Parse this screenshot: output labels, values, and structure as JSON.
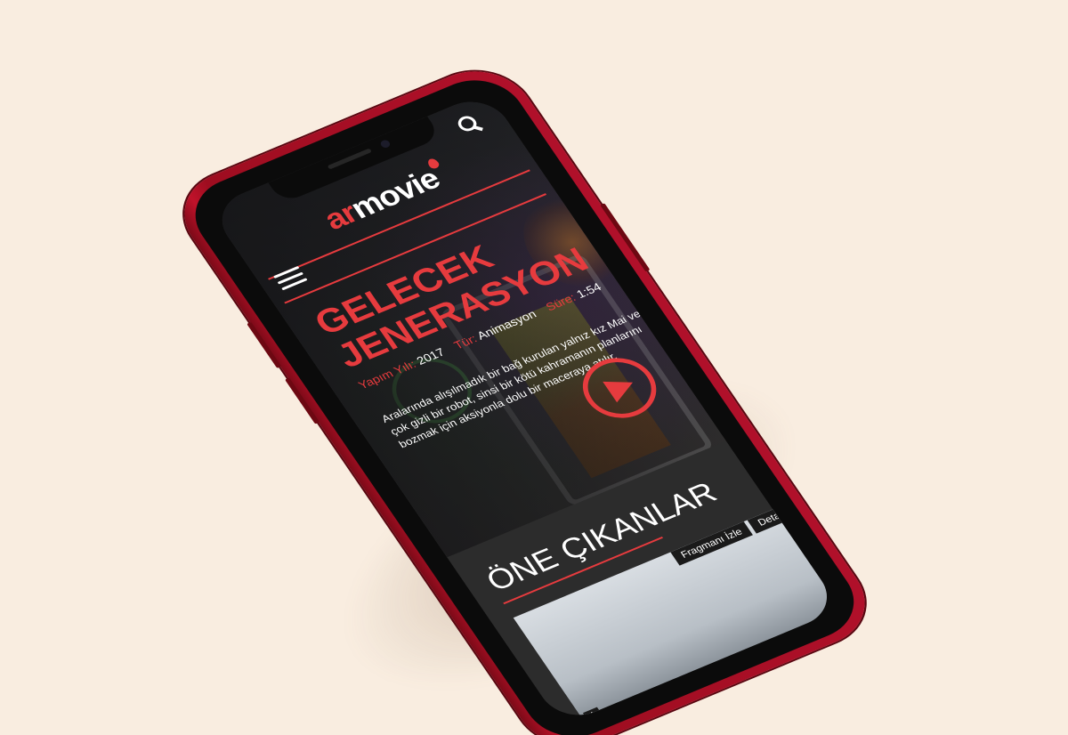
{
  "app": {
    "logo_ar": "ar",
    "logo_movie": "movie"
  },
  "hero": {
    "title": "GELECEK JENERASYON",
    "meta": [
      {
        "key": "Yapım Yılı:",
        "value": "2017"
      },
      {
        "key": "Tür:",
        "value": "Animasyon"
      },
      {
        "key": "Süre:",
        "value": "1:54"
      }
    ],
    "description": "Aralarında alışılmadık bir bağ kurulan yalnız kız Mai ve çok gizli bir robot, sinsi bir kötü kahramanın planlarını bozmak için aksiyonla dolu bir maceraya atılır."
  },
  "featured": {
    "title": "ÖNE ÇIKANLAR",
    "card": {
      "trailer_label": "Fragmanı İzle",
      "detail_label": "Detay",
      "plus_label": "+"
    }
  },
  "colors": {
    "accent": "#e63b3e",
    "background": "#f9ede0",
    "phone_body": "#b0102a",
    "screen_bg": "#2b2b2b"
  },
  "icons": {
    "menu": "hamburger-icon",
    "search": "search-icon",
    "play": "play-icon"
  }
}
